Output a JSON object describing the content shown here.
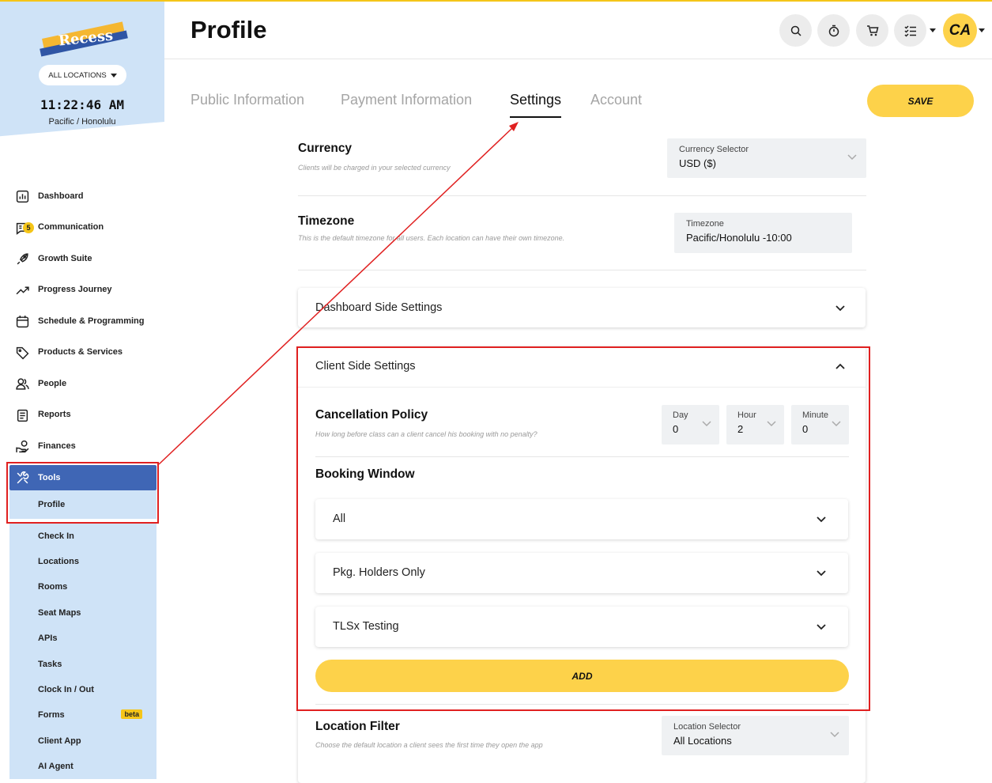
{
  "app": {
    "logo_text": "Recess",
    "location_button": "ALL LOCATIONS",
    "clock": "11:22:46 AM",
    "timezone": "Pacific / Honolulu"
  },
  "sidebar": {
    "items": [
      {
        "label": "Dashboard",
        "icon": "chart-icon"
      },
      {
        "label": "Communication",
        "icon": "message-icon",
        "badge": "5"
      },
      {
        "label": "Growth Suite",
        "icon": "rocket-icon"
      },
      {
        "label": "Progress Journey",
        "icon": "trend-icon"
      },
      {
        "label": "Schedule & Programming",
        "icon": "calendar-icon"
      },
      {
        "label": "Products & Services",
        "icon": "tag-icon"
      },
      {
        "label": "People",
        "icon": "people-icon"
      },
      {
        "label": "Reports",
        "icon": "report-icon"
      },
      {
        "label": "Finances",
        "icon": "finances-icon"
      },
      {
        "label": "Tools",
        "icon": "tools-icon",
        "active": true
      }
    ],
    "subitems": [
      {
        "label": "Profile",
        "active": true
      },
      {
        "label": "Check In"
      },
      {
        "label": "Locations"
      },
      {
        "label": "Rooms"
      },
      {
        "label": "Seat Maps"
      },
      {
        "label": "APIs"
      },
      {
        "label": "Tasks"
      },
      {
        "label": "Clock In / Out"
      },
      {
        "label": "Forms",
        "badge": "beta"
      },
      {
        "label": "Client App"
      },
      {
        "label": "AI Agent"
      }
    ]
  },
  "header": {
    "title": "Profile",
    "avatar_initials": "CA"
  },
  "tabs": [
    {
      "label": "Public Information"
    },
    {
      "label": "Payment Information"
    },
    {
      "label": "Settings",
      "active": true
    },
    {
      "label": "Account"
    }
  ],
  "save_label": "SAVE",
  "settings": {
    "currency": {
      "title": "Currency",
      "desc": "Clients will be charged in your selected currency",
      "select_label": "Currency Selector",
      "select_value": "USD ($)"
    },
    "timezone": {
      "title": "Timezone",
      "desc": "This is the default timezone for all users. Each location can have their own timezone.",
      "select_label": "Timezone",
      "select_value": "Pacific/Honolulu -10:00"
    },
    "dashboard_side": "Dashboard Side Settings",
    "client_side": "Client Side Settings",
    "cancellation": {
      "title": "Cancellation Policy",
      "desc": "How long before class can a client cancel his booking with no penalty?",
      "day_label": "Day",
      "day_value": "0",
      "hour_label": "Hour",
      "hour_value": "2",
      "minute_label": "Minute",
      "minute_value": "0"
    },
    "booking_window": {
      "title": "Booking Window",
      "items": [
        "All",
        "Pkg. Holders Only",
        "TLSx Testing"
      ],
      "add_label": "ADD"
    },
    "location_filter": {
      "title": "Location Filter",
      "desc": "Choose the default location a client sees the first time they open the app",
      "select_label": "Location Selector",
      "select_value": "All Locations"
    }
  },
  "colors": {
    "accent_yellow": "#fdd24a",
    "sidebar_blue": "#3f66b5",
    "sidebar_light": "#cfe3f7",
    "annotation_red": "#e02020"
  }
}
